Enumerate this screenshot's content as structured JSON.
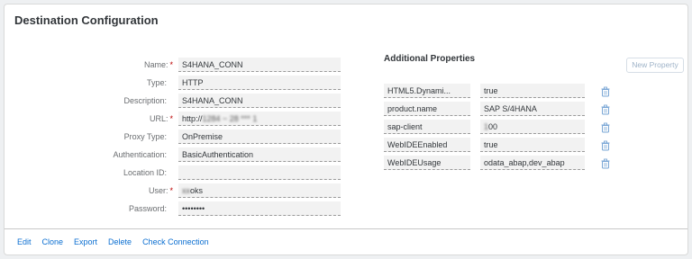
{
  "title": "Destination Configuration",
  "form": {
    "fields": [
      {
        "label": "Name:",
        "required": true,
        "value": "S4HANA_CONN",
        "blurred": false
      },
      {
        "label": "Type:",
        "required": false,
        "value": "HTTP",
        "blurred": false
      },
      {
        "label": "Description:",
        "required": false,
        "value": "S4HANA_CONN",
        "blurred": false
      },
      {
        "label": "URL:",
        "required": true,
        "value": "http://",
        "value_blurred": "1284 ~ 28 *** 1",
        "blurred": true
      },
      {
        "label": "Proxy Type:",
        "required": false,
        "value": "OnPremise",
        "blurred": false
      },
      {
        "label": "Authentication:",
        "required": false,
        "value": "BasicAuthentication",
        "blurred": false
      },
      {
        "label": "Location ID:",
        "required": false,
        "value": "",
        "blurred": false
      },
      {
        "label": "User:",
        "required": true,
        "value": "oks",
        "value_blurred": "xx",
        "blurred": true
      },
      {
        "label": "Password:",
        "required": false,
        "value": "••••••••",
        "blurred": false
      }
    ],
    "required_marker": "*"
  },
  "additional_properties": {
    "title": "Additional Properties",
    "new_button": "New Property",
    "rows": [
      {
        "key": "HTML5.Dynami...",
        "value": "true"
      },
      {
        "key": "product.name",
        "value": "SAP S/4HANA"
      },
      {
        "key": "sap-client",
        "value": "00",
        "value_blurred": "1"
      },
      {
        "key": "WebIDEEnabled",
        "value": "true"
      },
      {
        "key": "WebIDEUsage",
        "value": "odata_abap,dev_abap"
      }
    ],
    "delete_icon": "trash-icon"
  },
  "footer": {
    "actions": [
      "Edit",
      "Clone",
      "Export",
      "Delete",
      "Check Connection"
    ]
  },
  "colors": {
    "accent": "#0a6ed1",
    "required": "#bb0000",
    "field_bg": "#f2f2f2"
  }
}
